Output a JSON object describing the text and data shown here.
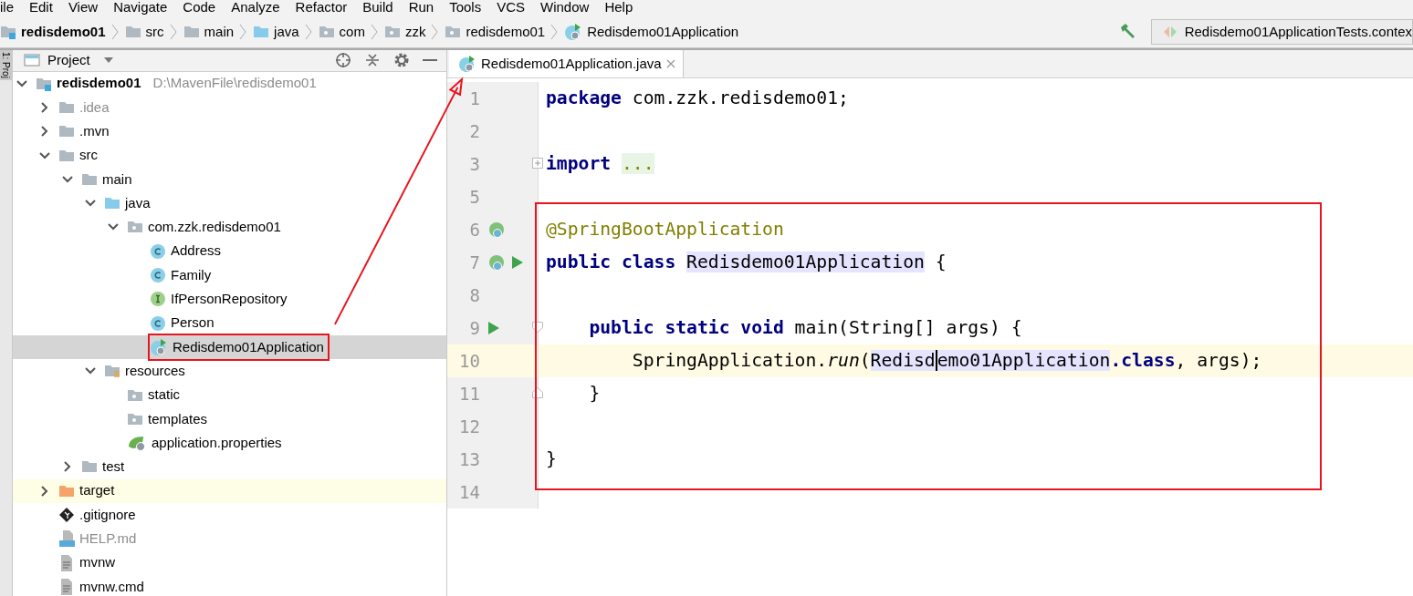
{
  "menu": [
    "ile",
    "Edit",
    "View",
    "Navigate",
    "Code",
    "Analyze",
    "Refactor",
    "Build",
    "Run",
    "Tools",
    "VCS",
    "Window",
    "Help"
  ],
  "breadcrumbs": [
    {
      "label": "redisdemo01",
      "kind": "module"
    },
    {
      "label": "src",
      "kind": "folder"
    },
    {
      "label": "main",
      "kind": "folder"
    },
    {
      "label": "java",
      "kind": "source"
    },
    {
      "label": "com",
      "kind": "package"
    },
    {
      "label": "zzk",
      "kind": "package"
    },
    {
      "label": "redisdemo01",
      "kind": "package"
    },
    {
      "label": "Redisdemo01Application",
      "kind": "app-class"
    }
  ],
  "run_config": {
    "label": "Redisdemo01ApplicationTests.contex"
  },
  "side_stripe": {
    "label": "1: Proj"
  },
  "project_panel": {
    "title": "Project",
    "tree": [
      {
        "label": "redisdemo01",
        "path": "D:\\MavenFile\\redisdemo01",
        "kind": "module",
        "expanded": true,
        "selected": false,
        "highlighted": false,
        "dim": false,
        "boxed": false,
        "children": [
          {
            "label": ".idea",
            "kind": "folder",
            "expanded": false,
            "selected": false,
            "highlighted": false,
            "dim": true,
            "boxed": false
          },
          {
            "label": ".mvn",
            "kind": "folder",
            "expanded": false,
            "selected": false,
            "highlighted": false,
            "dim": false,
            "boxed": false
          },
          {
            "label": "src",
            "kind": "folder",
            "expanded": true,
            "selected": false,
            "highlighted": false,
            "dim": false,
            "boxed": false,
            "children": [
              {
                "label": "main",
                "kind": "folder",
                "expanded": true,
                "selected": false,
                "highlighted": false,
                "dim": false,
                "boxed": false,
                "children": [
                  {
                    "label": "java",
                    "kind": "source",
                    "expanded": true,
                    "selected": false,
                    "highlighted": false,
                    "dim": false,
                    "boxed": false,
                    "children": [
                      {
                        "label": "com.zzk.redisdemo01",
                        "kind": "package",
                        "expanded": true,
                        "selected": false,
                        "highlighted": false,
                        "dim": false,
                        "boxed": false,
                        "children": [
                          {
                            "label": "Address",
                            "kind": "class",
                            "selected": false,
                            "highlighted": false,
                            "dim": false,
                            "boxed": false
                          },
                          {
                            "label": "Family",
                            "kind": "class",
                            "selected": false,
                            "highlighted": false,
                            "dim": false,
                            "boxed": false
                          },
                          {
                            "label": "IfPersonRepository",
                            "kind": "interface",
                            "selected": false,
                            "highlighted": false,
                            "dim": false,
                            "boxed": false
                          },
                          {
                            "label": "Person",
                            "kind": "class",
                            "selected": false,
                            "highlighted": false,
                            "dim": false,
                            "boxed": false
                          },
                          {
                            "label": "Redisdemo01Application",
                            "kind": "app-class",
                            "selected": true,
                            "highlighted": false,
                            "dim": false,
                            "boxed": true
                          }
                        ]
                      }
                    ]
                  },
                  {
                    "label": "resources",
                    "kind": "resources",
                    "expanded": true,
                    "selected": false,
                    "highlighted": false,
                    "dim": false,
                    "boxed": false,
                    "children": [
                      {
                        "label": "static",
                        "kind": "package",
                        "selected": false,
                        "highlighted": false,
                        "dim": false,
                        "boxed": false
                      },
                      {
                        "label": "templates",
                        "kind": "package",
                        "selected": false,
                        "highlighted": false,
                        "dim": false,
                        "boxed": false
                      },
                      {
                        "label": "application.properties",
                        "kind": "properties",
                        "selected": false,
                        "highlighted": false,
                        "dim": false,
                        "boxed": false
                      }
                    ]
                  }
                ]
              },
              {
                "label": "test",
                "kind": "folder",
                "expanded": false,
                "selected": false,
                "highlighted": false,
                "dim": false,
                "boxed": false
              }
            ]
          },
          {
            "label": "target",
            "kind": "excluded",
            "expanded": false,
            "selected": false,
            "highlighted": true,
            "dim": false,
            "boxed": false
          },
          {
            "label": ".gitignore",
            "kind": "git",
            "selected": false,
            "highlighted": false,
            "dim": false,
            "boxed": false
          },
          {
            "label": "HELP.md",
            "kind": "md",
            "selected": false,
            "highlighted": false,
            "dim": true,
            "boxed": false
          },
          {
            "label": "mvnw",
            "kind": "text",
            "selected": false,
            "highlighted": false,
            "dim": false,
            "boxed": false
          },
          {
            "label": "mvnw.cmd",
            "kind": "text",
            "selected": false,
            "highlighted": false,
            "dim": false,
            "boxed": false
          }
        ]
      }
    ]
  },
  "editor": {
    "tabs": [
      {
        "label": "Redisdemo01Application.java",
        "selected": true
      }
    ],
    "arrow_to_tab": true,
    "blocks": [
      {
        "framed": false,
        "lines": [
          {
            "number": "1",
            "current": false,
            "tokens": [
              {
                "kind": "kw",
                "text": "package"
              },
              {
                "kind": "plain",
                "text": " com.zzk.redisdemo01;"
              }
            ]
          },
          {
            "number": "2",
            "current": false
          },
          {
            "number": "3",
            "current": false,
            "fold": {
              "kind": "collapsed"
            },
            "tokens": [
              {
                "kind": "kw",
                "text": "import"
              },
              {
                "kind": "folded",
                "text": "..."
              }
            ]
          },
          {
            "number": "5",
            "current": false
          }
        ]
      },
      {
        "framed": true,
        "lines": [
          {
            "number": "6",
            "current": false,
            "gutter": [
              {
                "kind": "bean"
              }
            ],
            "tokens": [
              {
                "kind": "annotation",
                "text": "@SpringBootApplication"
              }
            ]
          },
          {
            "number": "7",
            "current": false,
            "gutter": [
              {
                "kind": "bean"
              },
              {
                "kind": "run"
              }
            ],
            "tokens": [
              {
                "kind": "kw",
                "text": "public class "
              },
              {
                "kind": "usage",
                "text": "Redisdemo01Application"
              },
              {
                "kind": "plain",
                "text": " {"
              }
            ]
          },
          {
            "number": "8",
            "current": false
          },
          {
            "number": "9",
            "current": false,
            "gutter": [
              {
                "kind": "run"
              }
            ],
            "fold": {
              "kind": "start"
            },
            "tokens": [
              {
                "kind": "kw",
                "text": "    public static void"
              },
              {
                "kind": "plain",
                "text": " main(String[] args) {"
              }
            ]
          },
          {
            "number": "10",
            "current": true,
            "tokens": [
              {
                "kind": "plain",
                "text": "        SpringApplication."
              },
              {
                "kind": "italic",
                "text": "run"
              },
              {
                "kind": "plain",
                "text": "("
              },
              {
                "kind": "usage",
                "text": "Redisd",
                "caret": true
              },
              {
                "kind": "usage",
                "text": "emo01Application"
              },
              {
                "kind": "kw",
                "text": ".class"
              },
              {
                "kind": "plain",
                "text": ", args);"
              }
            ]
          },
          {
            "number": "11",
            "current": false,
            "fold": {
              "kind": "end"
            },
            "tokens": [
              {
                "kind": "plain",
                "text": "    }"
              }
            ]
          },
          {
            "number": "12",
            "current": false
          },
          {
            "number": "13",
            "current": false,
            "tokens": [
              {
                "kind": "plain",
                "text": "}"
              }
            ]
          }
        ]
      },
      {
        "framed": false,
        "lines": [
          {
            "number": "14",
            "current": false
          }
        ]
      }
    ]
  }
}
